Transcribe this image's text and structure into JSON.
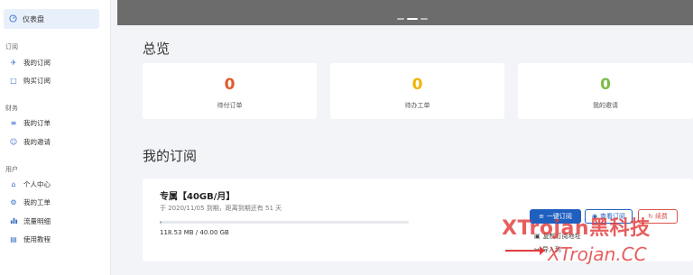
{
  "sidebar": {
    "active": {
      "label": "仪表盘",
      "icon": "dashboard-icon"
    },
    "groups": [
      {
        "label": "订阅",
        "items": [
          {
            "label": "我的订阅",
            "icon": "rocket-icon"
          },
          {
            "label": "购买订阅",
            "icon": "cart-icon"
          }
        ]
      },
      {
        "label": "财务",
        "items": [
          {
            "label": "我的订单",
            "icon": "list-icon"
          },
          {
            "label": "我的邀请",
            "icon": "invite-icon"
          }
        ]
      },
      {
        "label": "用户",
        "items": [
          {
            "label": "个人中心",
            "icon": "user-icon"
          },
          {
            "label": "我的工单",
            "icon": "gear-icon"
          },
          {
            "label": "流量明细",
            "icon": "bar-chart-icon"
          },
          {
            "label": "使用教程",
            "icon": "book-icon"
          }
        ]
      }
    ]
  },
  "overview": {
    "title": "总览",
    "cards": [
      {
        "value": "0",
        "label": "待付订单",
        "color": "#e05a2b"
      },
      {
        "value": "0",
        "label": "待办工单",
        "color": "#f0b400"
      },
      {
        "value": "0",
        "label": "我的邀请",
        "color": "#7dbb4a"
      }
    ]
  },
  "subscription": {
    "title": "我的订阅",
    "plan_name": "专属【40GB/月】",
    "expiry": "于 2020/11/05 到期，距离到期还有 51 天",
    "usage": "118.53 MB / 40.00 GB",
    "usage_fraction": 0.003,
    "buttons": {
      "subscribe": "一键订阅",
      "view": "查看订阅",
      "reset": "续费"
    },
    "links": {
      "copy": "复制订阅地址",
      "import": "导入到"
    }
  },
  "watermark": {
    "line1": "XTrojan黑科技",
    "line2": "XTrojan.CC"
  },
  "colors": {
    "accent": "#1f5fbf",
    "danger": "#d9534f"
  }
}
